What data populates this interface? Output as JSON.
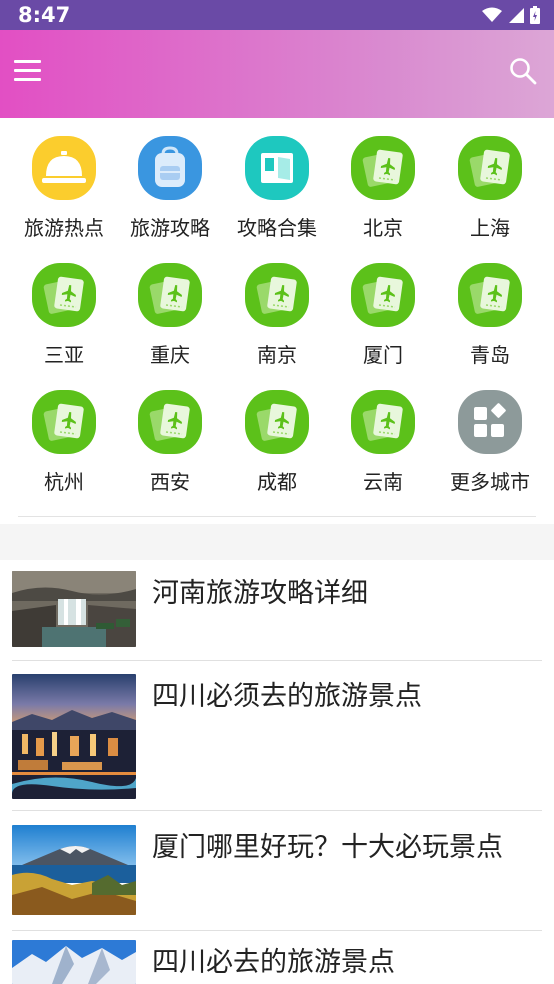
{
  "status_bar": {
    "time": "8:47",
    "icons": [
      "wifi-icon",
      "cellular-signal-icon",
      "battery-icon"
    ]
  },
  "app_bar": {
    "menu_icon": "hamburger-menu-icon",
    "search_icon": "search-icon",
    "gradient_colors": [
      "#e24fc4",
      "#dca6d6"
    ]
  },
  "categories": [
    {
      "label": "旅游热点",
      "icon": "service-bell-icon",
      "color": "#fbcd2d"
    },
    {
      "label": "旅游攻略",
      "icon": "backpack-icon",
      "color": "#3a96e0"
    },
    {
      "label": "攻略合集",
      "icon": "map-book-icon",
      "color": "#1ec8bf"
    },
    {
      "label": "北京",
      "icon": "plane-ticket-icon",
      "color": "#5cc11a"
    },
    {
      "label": "上海",
      "icon": "plane-ticket-icon",
      "color": "#5cc11a"
    },
    {
      "label": "三亚",
      "icon": "plane-ticket-icon",
      "color": "#5cc11a"
    },
    {
      "label": "重庆",
      "icon": "plane-ticket-icon",
      "color": "#5cc11a"
    },
    {
      "label": "南京",
      "icon": "plane-ticket-icon",
      "color": "#5cc11a"
    },
    {
      "label": "厦门",
      "icon": "plane-ticket-icon",
      "color": "#5cc11a"
    },
    {
      "label": "青岛",
      "icon": "plane-ticket-icon",
      "color": "#5cc11a"
    },
    {
      "label": "杭州",
      "icon": "plane-ticket-icon",
      "color": "#5cc11a"
    },
    {
      "label": "西安",
      "icon": "plane-ticket-icon",
      "color": "#5cc11a"
    },
    {
      "label": "成都",
      "icon": "plane-ticket-icon",
      "color": "#5cc11a"
    },
    {
      "label": "云南",
      "icon": "plane-ticket-icon",
      "color": "#5cc11a"
    },
    {
      "label": "更多城市",
      "icon": "more-apps-icon",
      "color": "#8d9a9a"
    }
  ],
  "articles": [
    {
      "title": "河南旅游攻略详细",
      "thumb": "waterfall-photo"
    },
    {
      "title": "四川必须去的旅游景点",
      "thumb": "city-night-photo"
    },
    {
      "title": "厦门哪里好玩？十大必玩景点",
      "thumb": "mountain-lake-photo"
    },
    {
      "title": "四川必去的旅游景点",
      "thumb": "snow-mountain-photo"
    }
  ]
}
